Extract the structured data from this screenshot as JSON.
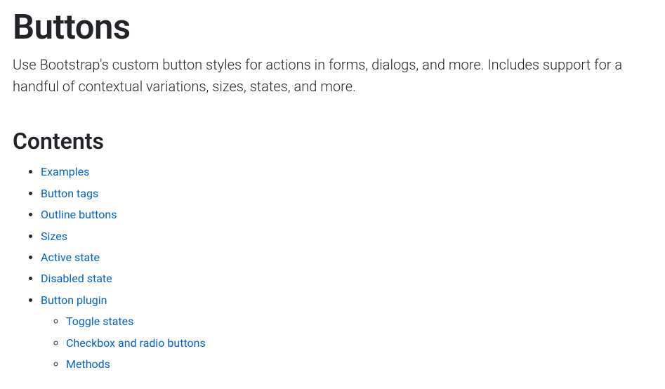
{
  "page": {
    "title": "Buttons",
    "lead": "Use Bootstrap's custom button styles for actions in forms, dialogs, and more. Includes support for a handful of contextual variations, sizes, states, and more."
  },
  "contents": {
    "heading": "Contents",
    "items": [
      {
        "label": "Examples"
      },
      {
        "label": "Button tags"
      },
      {
        "label": "Outline buttons"
      },
      {
        "label": "Sizes"
      },
      {
        "label": "Active state"
      },
      {
        "label": "Disabled state"
      },
      {
        "label": "Button plugin",
        "children": [
          {
            "label": "Toggle states"
          },
          {
            "label": "Checkbox and radio buttons"
          },
          {
            "label": "Methods"
          }
        ]
      }
    ]
  }
}
